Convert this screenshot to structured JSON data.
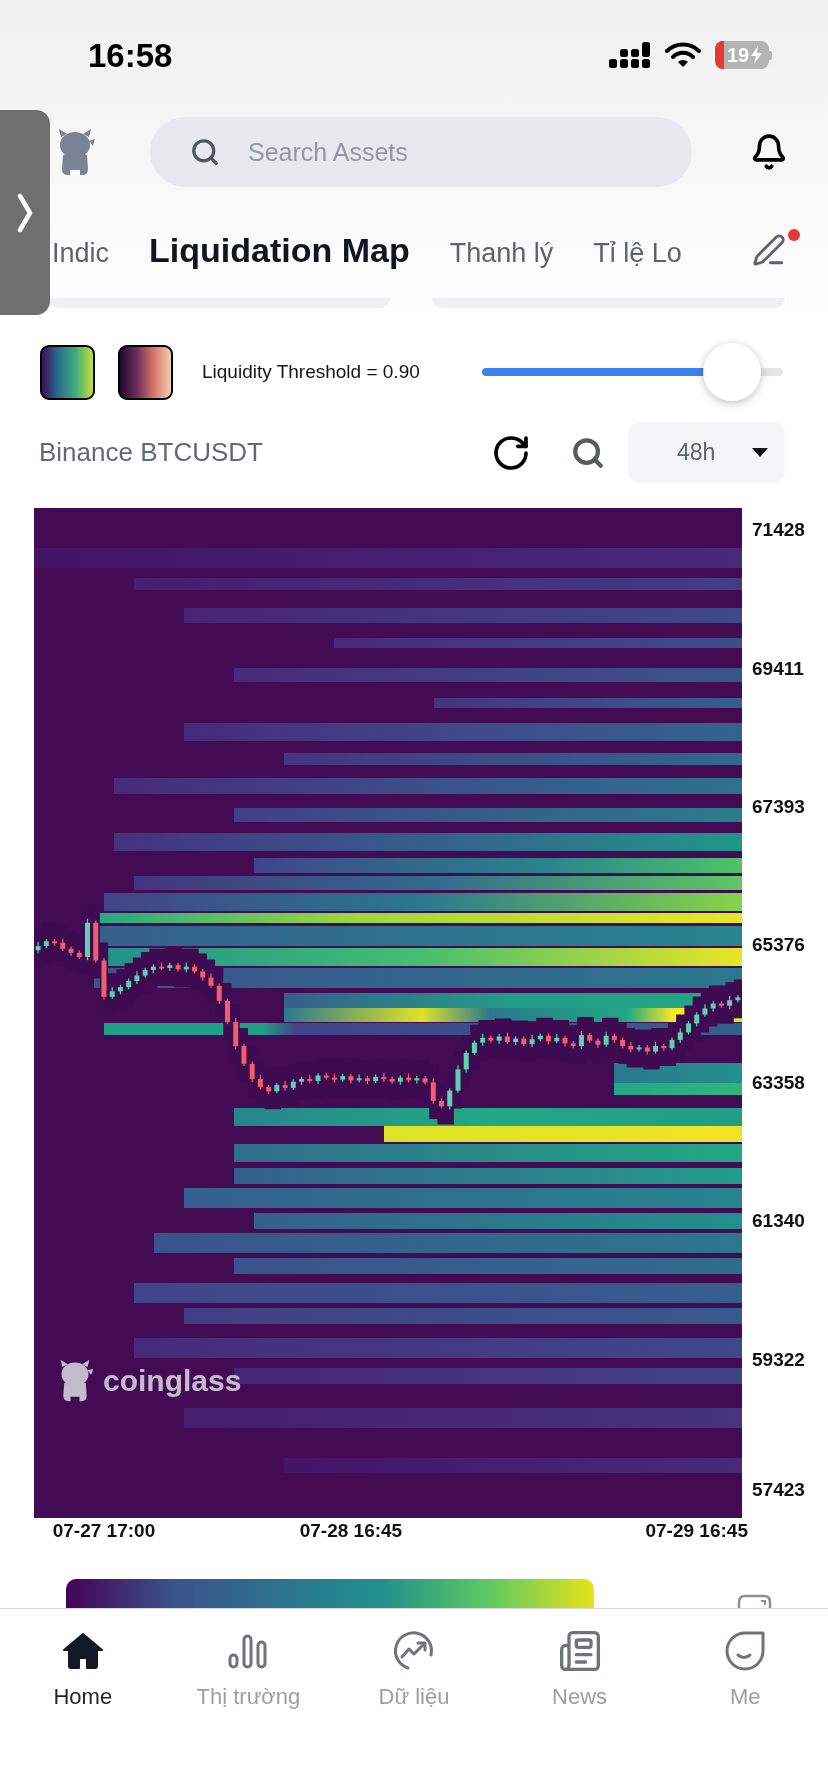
{
  "status_bar": {
    "time": "16:58",
    "battery": "19"
  },
  "search": {
    "placeholder": "Search Assets"
  },
  "tabs": [
    {
      "label": "Indic",
      "selected": false
    },
    {
      "label": "Liquidation Map",
      "selected": true
    },
    {
      "label": "Thanh lý",
      "selected": false
    },
    {
      "label": "Tỉ lệ Lo",
      "selected": false
    }
  ],
  "edit": {
    "dot": true
  },
  "color_schemes": [
    {
      "kind": "viridis"
    },
    {
      "kind": "sunset"
    }
  ],
  "threshold": {
    "label": "Liquidity Threshold = 0.90",
    "level": 0.83
  },
  "market": {
    "title": "Binance BTCUSDT",
    "range": "48h"
  },
  "chart": {
    "watermark": "coinglass",
    "chart_data": {
      "type": "candlestick",
      "categories": [
        null,
        null,
        null,
        null,
        null,
        null,
        null,
        null,
        "07-27 17:00",
        null,
        null,
        null,
        null,
        null,
        null,
        null,
        null,
        null,
        null,
        null,
        null,
        null,
        null,
        null,
        null,
        null,
        null,
        null,
        null,
        null,
        null,
        null,
        null,
        null,
        null,
        null,
        null,
        null,
        "07-28 16:45",
        null,
        null,
        null,
        null,
        null,
        null,
        null,
        null,
        null,
        null,
        null,
        null,
        null,
        null,
        null,
        null,
        null,
        null,
        null,
        null,
        null,
        null,
        null,
        null,
        null,
        null,
        null,
        null,
        null,
        null,
        null,
        null,
        null,
        null,
        null,
        null,
        null,
        null,
        null,
        null,
        null,
        "07-29 16:45",
        null,
        null,
        null,
        null,
        null
      ],
      "ohlc": [
        [
          65300,
          65420,
          65255,
          65360
        ],
        [
          65360,
          65465,
          65330,
          65430
        ],
        [
          65430,
          65465,
          65365,
          65410
        ],
        [
          65410,
          65470,
          65290,
          65320
        ],
        [
          65320,
          65355,
          65215,
          65260
        ],
        [
          65260,
          65295,
          65170,
          65200
        ],
        [
          65200,
          65760,
          65155,
          65700
        ],
        [
          65700,
          65735,
          65120,
          65150
        ],
        [
          65150,
          65185,
          64575,
          64620
        ],
        [
          64620,
          64760,
          64590,
          64700
        ],
        [
          64700,
          64795,
          64655,
          64760
        ],
        [
          64760,
          64885,
          64730,
          64850
        ],
        [
          64850,
          64990,
          64805,
          64930
        ],
        [
          64930,
          65045,
          64900,
          65010
        ],
        [
          65010,
          65095,
          64965,
          65060
        ],
        [
          65060,
          65120,
          65010,
          65040
        ],
        [
          65040,
          65115,
          64995,
          65080
        ],
        [
          65080,
          65115,
          64990,
          65020
        ],
        [
          65020,
          65120,
          64975,
          65060
        ],
        [
          65060,
          65095,
          64960,
          64990
        ],
        [
          64990,
          65025,
          64855,
          64900
        ],
        [
          64900,
          64960,
          64750,
          64780
        ],
        [
          64780,
          64815,
          64515,
          64560
        ],
        [
          64560,
          64595,
          64220,
          64250
        ],
        [
          64250,
          64310,
          63855,
          63900
        ],
        [
          63900,
          63935,
          63610,
          63640
        ],
        [
          63640,
          63675,
          63375,
          63420
        ],
        [
          63420,
          63480,
          63270,
          63300
        ],
        [
          63300,
          63335,
          63195,
          63240
        ],
        [
          63240,
          63365,
          63210,
          63330
        ],
        [
          63330,
          63390,
          63245,
          63290
        ],
        [
          63290,
          63415,
          63260,
          63380
        ],
        [
          63380,
          63455,
          63335,
          63420
        ],
        [
          63420,
          63480,
          63360,
          63390
        ],
        [
          63390,
          63505,
          63345,
          63470
        ],
        [
          63470,
          63505,
          63410,
          63440
        ],
        [
          63440,
          63500,
          63365,
          63410
        ],
        [
          63410,
          63495,
          63380,
          63460
        ],
        [
          63460,
          63495,
          63355,
          63400
        ],
        [
          63400,
          63490,
          63370,
          63430
        ],
        [
          63430,
          63465,
          63345,
          63390
        ],
        [
          63390,
          63485,
          63360,
          63450
        ],
        [
          63450,
          63510,
          63375,
          63420
        ],
        [
          63420,
          63455,
          63350,
          63380
        ],
        [
          63380,
          63475,
          63335,
          63440
        ],
        [
          63440,
          63500,
          63370,
          63400
        ],
        [
          63400,
          63465,
          63355,
          63430
        ],
        [
          63430,
          63465,
          63340,
          63370
        ],
        [
          63370,
          63430,
          63055,
          63100
        ],
        [
          63100,
          63135,
          62990,
          63020
        ],
        [
          63020,
          63285,
          62975,
          63250
        ],
        [
          63250,
          63620,
          63220,
          63560
        ],
        [
          63560,
          63835,
          63515,
          63800
        ],
        [
          63800,
          63985,
          63770,
          63950
        ],
        [
          63950,
          64080,
          63905,
          64020
        ],
        [
          64020,
          64055,
          63950,
          63980
        ],
        [
          63980,
          64075,
          63935,
          64040
        ],
        [
          64040,
          64100,
          63930,
          63960
        ],
        [
          63960,
          64045,
          63915,
          64010
        ],
        [
          64010,
          64045,
          63900,
          63930
        ],
        [
          63930,
          64060,
          63885,
          64000
        ],
        [
          64000,
          64085,
          63970,
          64050
        ],
        [
          64050,
          64085,
          63925,
          63970
        ],
        [
          63970,
          64080,
          63940,
          64020
        ],
        [
          64020,
          64055,
          63895,
          63940
        ],
        [
          63940,
          63975,
          63870,
          63900
        ],
        [
          63900,
          64120,
          63855,
          64060
        ],
        [
          64060,
          64095,
          63950,
          63980
        ],
        [
          63980,
          64015,
          63875,
          63920
        ],
        [
          63920,
          64110,
          63890,
          64050
        ],
        [
          64050,
          64085,
          63945,
          63990
        ],
        [
          63990,
          64025,
          63870,
          63900
        ],
        [
          63900,
          63960,
          63805,
          63850
        ],
        [
          63850,
          63915,
          63820,
          63880
        ],
        [
          63880,
          63915,
          63775,
          63820
        ],
        [
          63820,
          63960,
          63790,
          63900
        ],
        [
          63900,
          63935,
          63825,
          63870
        ],
        [
          63870,
          64025,
          63840,
          63990
        ],
        [
          63990,
          64160,
          63945,
          64100
        ],
        [
          64100,
          64265,
          64070,
          64230
        ],
        [
          64230,
          64395,
          64185,
          64360
        ],
        [
          64360,
          64510,
          64330,
          64450
        ],
        [
          64450,
          64555,
          64405,
          64520
        ],
        [
          64520,
          64555,
          64460,
          64490
        ],
        [
          64490,
          64630,
          64445,
          64570
        ],
        [
          64570,
          64645,
          64540,
          64610
        ]
      ],
      "ylim": [
        57010,
        71756
      ],
      "yticks": [
        {
          "value": 71428,
          "label": "71428"
        },
        {
          "value": 69411,
          "label": "69411"
        },
        {
          "value": 67393,
          "label": "67393"
        },
        {
          "value": 65376,
          "label": "65376"
        },
        {
          "value": 63358,
          "label": "63358"
        },
        {
          "value": 61340,
          "label": "61340"
        },
        {
          "value": 59322,
          "label": "59322"
        },
        {
          "value": 57423,
          "label": "57423"
        }
      ]
    }
  },
  "nav": [
    {
      "kind": "home",
      "label": "Home",
      "selected": true
    },
    {
      "kind": "market",
      "label": "Thị trường",
      "selected": false
    },
    {
      "kind": "data",
      "label": "Dữ liệu",
      "selected": false
    },
    {
      "kind": "news",
      "label": "News",
      "selected": false
    },
    {
      "kind": "me",
      "label": "Me",
      "selected": false
    }
  ]
}
